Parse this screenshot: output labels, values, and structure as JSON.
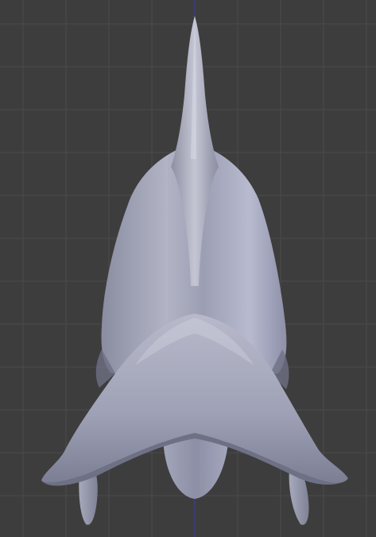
{
  "viewport": {
    "background_color": "#3d3d3d",
    "grid_color": "#4a4a4a",
    "axis_color": "#3b3fa0",
    "grid": true,
    "axis": "vertical-z-axis"
  },
  "model": {
    "name": "sculpted-creature-mesh",
    "view": "front",
    "shading": "matcap-grey",
    "base_color": "#a9abc0",
    "shadow_color": "#6e7085",
    "highlight_color": "#d7d8e2"
  }
}
